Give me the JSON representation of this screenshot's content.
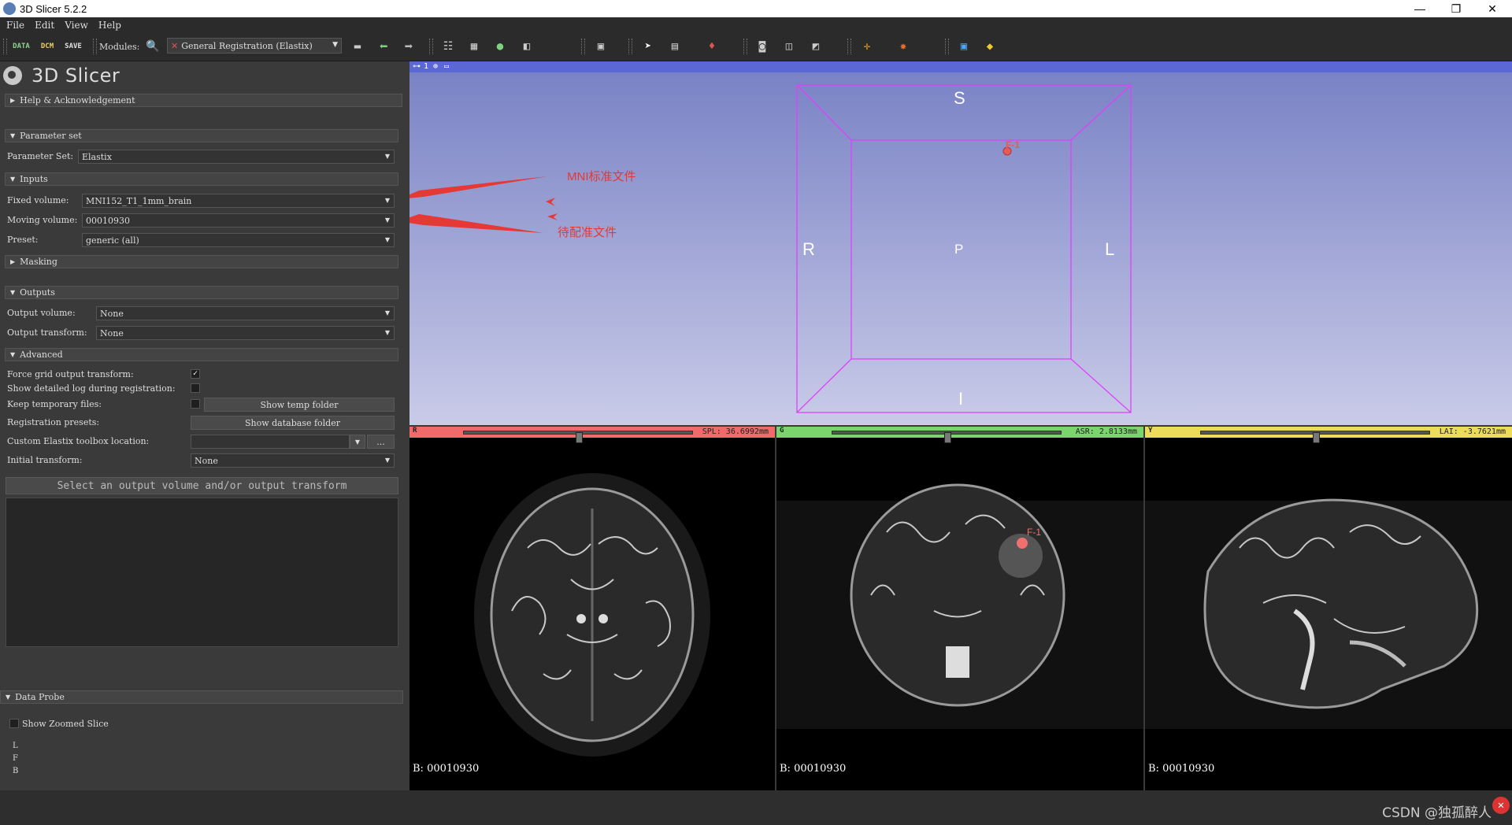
{
  "window": {
    "title": "3D Slicer 5.2.2",
    "minimize": "—",
    "maximize": "❐",
    "close": "✕"
  },
  "menu": [
    "File",
    "Edit",
    "View",
    "Help"
  ],
  "toolbar": {
    "data_label": "DATA",
    "dcm_label": "DCM",
    "save_label": "SAVE",
    "modules_label": "Modules:",
    "module_selected": "General Registration (Elastix)"
  },
  "app": {
    "name": "3D Slicer"
  },
  "panel": {
    "help_section": "Help & Acknowledgement",
    "parameter_section": "Parameter set",
    "parameter_set_label": "Parameter Set:",
    "parameter_set_value": "Elastix",
    "inputs_section": "Inputs",
    "fixed_label": "Fixed volume:",
    "fixed_value": "MNI152_T1_1mm_brain",
    "moving_label": "Moving volume:",
    "moving_value": "00010930",
    "preset_label": "Preset:",
    "preset_value": "generic (all)",
    "masking_section": "Masking",
    "outputs_section": "Outputs",
    "output_volume_label": "Output volume:",
    "output_volume_value": "None",
    "output_transform_label": "Output transform:",
    "output_transform_value": "None",
    "advanced_section": "Advanced",
    "force_grid_label": "Force grid output transform:",
    "force_grid_checked": "✓",
    "detailed_log_label": "Show detailed log during registration:",
    "keep_temp_label": "Keep temporary files:",
    "show_temp_button": "Show temp folder",
    "reg_presets_label": "Registration presets:",
    "show_db_button": "Show database folder",
    "custom_loc_label": "Custom Elastix toolbox location:",
    "browse_button": "...",
    "initial_transform_label": "Initial transform:",
    "initial_transform_value": "None",
    "apply_button": "Select an output volume and/or output transform"
  },
  "probe": {
    "section": "Data Probe",
    "zoom_label": "Show Zoomed Slice",
    "l": "L",
    "f": "F",
    "b": "B"
  },
  "view3d": {
    "layout_num": "1",
    "s": "S",
    "i": "I",
    "r": "R",
    "l": "L",
    "p": "P",
    "fiducial": "F-1"
  },
  "annotations": {
    "fixed_note": "MNI标准文件",
    "moving_note": "待配准文件"
  },
  "slices": [
    {
      "letter": "R",
      "value": "SPL: 36.6992mm",
      "name": "B: 00010930",
      "color": "#f06a6a",
      "offset": 0.5
    },
    {
      "letter": "G",
      "value": "ASR: 2.8133mm",
      "name": "B: 00010930",
      "color": "#7bd46e",
      "offset": 0.5
    },
    {
      "letter": "Y",
      "value": "LAI: -3.7621mm",
      "name": "B: 00010930",
      "color": "#eddc5a",
      "offset": 0.5
    }
  ],
  "slice_fiducial": "F-1",
  "watermark": "CSDN @独孤醉人"
}
